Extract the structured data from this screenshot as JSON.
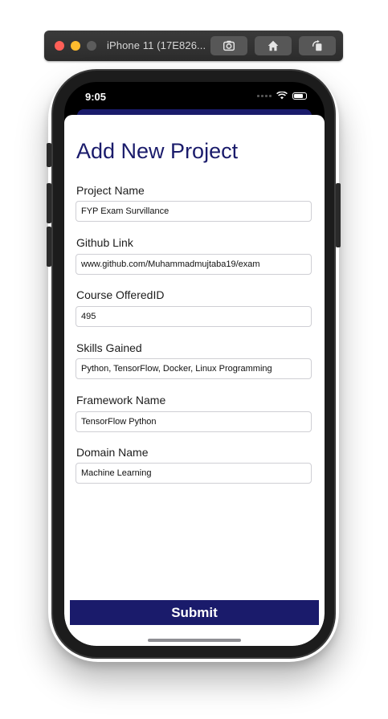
{
  "simulator": {
    "title": "iPhone 11 (17E826..."
  },
  "status_bar": {
    "time": "9:05"
  },
  "page": {
    "title": "Add New Project"
  },
  "form": {
    "fields": [
      {
        "label": "Project Name",
        "value": "FYP Exam Survillance"
      },
      {
        "label": "Github Link",
        "value": "www.github.com/Muhammadmujtaba19/exam"
      },
      {
        "label": "Course OfferedID",
        "value": "495"
      },
      {
        "label": "Skills Gained",
        "value": "Python, TensorFlow, Docker, Linux Programming"
      },
      {
        "label": "Framework Name",
        "value": "TensorFlow Python"
      },
      {
        "label": "Domain Name",
        "value": "Machine Learning"
      }
    ],
    "submit_label": "Submit"
  },
  "colors": {
    "accent": "#1a1b6b",
    "text": "#1c1c1c",
    "input_border": "#cfcfd4"
  },
  "icons": {
    "toolbar": [
      "screenshot-icon",
      "home-icon",
      "rotate-icon"
    ],
    "status": [
      "wifi-icon",
      "battery-icon"
    ]
  }
}
